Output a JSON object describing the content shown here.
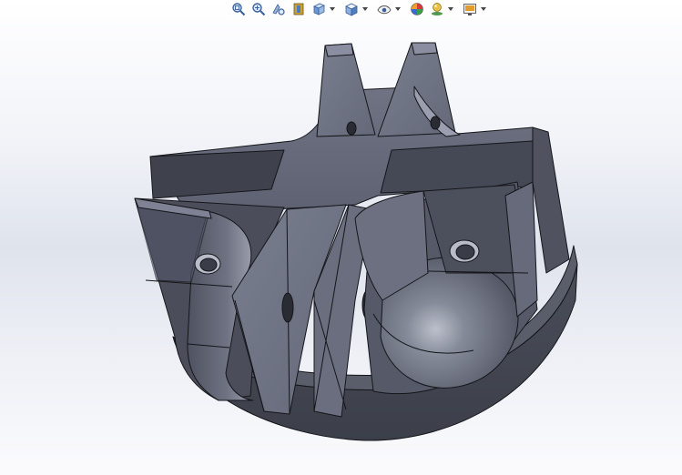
{
  "toolbar": {
    "buttons": [
      {
        "icon": "zoom-to-fit-icon",
        "has_dropdown": false
      },
      {
        "icon": "zoom-to-area-icon",
        "has_dropdown": false
      },
      {
        "icon": "previous-view-icon",
        "has_dropdown": false
      },
      {
        "icon": "section-view-icon",
        "has_dropdown": false
      },
      {
        "icon": "view-orientation-icon",
        "has_dropdown": true
      },
      {
        "icon": "display-style-icon",
        "has_dropdown": true
      },
      {
        "icon": "hide-show-items-icon",
        "has_dropdown": true
      },
      {
        "icon": "edit-appearance-icon",
        "has_dropdown": false
      },
      {
        "icon": "apply-scene-icon",
        "has_dropdown": true
      },
      {
        "icon": "view-settings-icon",
        "has_dropdown": true
      }
    ]
  },
  "viewport": {
    "background_top": "#ffffff",
    "background_mid": "#dfe3ec",
    "model_color": "#5d6170"
  }
}
